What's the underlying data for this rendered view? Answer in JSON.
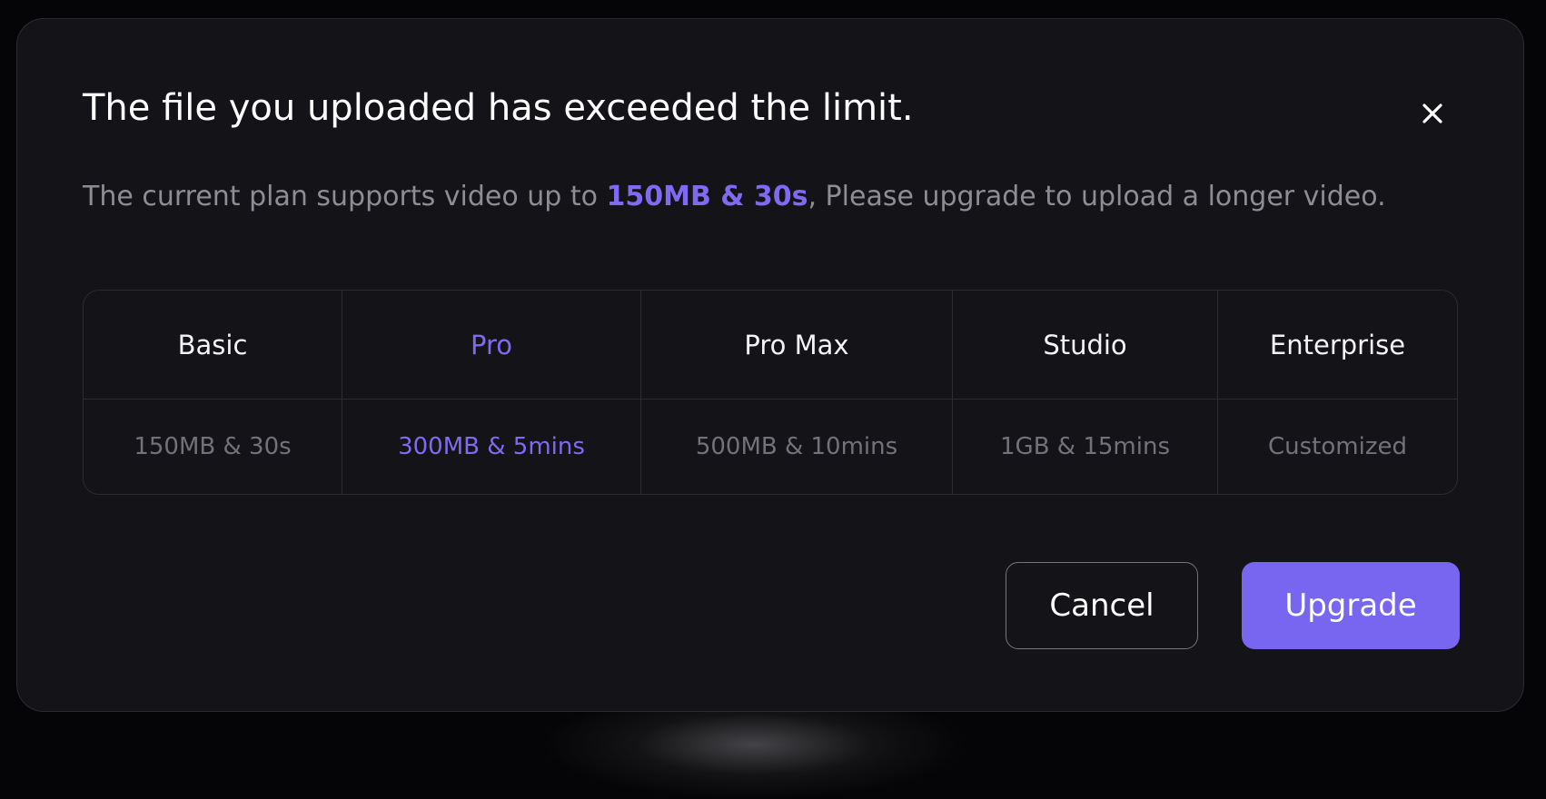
{
  "dialog": {
    "title": "The file you uploaded has exceeded the limit.",
    "subtitle_prefix": "The current plan supports video up to ",
    "subtitle_highlight": "150MB & 30s",
    "subtitle_suffix": ", Please upgrade to upload a longer video.",
    "close_icon": "close-icon"
  },
  "plans": [
    {
      "name": "Basic",
      "limit": "150MB & 30s",
      "highlighted": false
    },
    {
      "name": "Pro",
      "limit": "300MB & 5mins",
      "highlighted": true
    },
    {
      "name": "Pro Max",
      "limit": "500MB & 10mins",
      "highlighted": false
    },
    {
      "name": "Studio",
      "limit": "1GB & 15mins",
      "highlighted": false
    },
    {
      "name": "Enterprise",
      "limit": "Customized",
      "highlighted": false
    }
  ],
  "actions": {
    "cancel_label": "Cancel",
    "upgrade_label": "Upgrade"
  },
  "colors": {
    "accent": "#7866f0",
    "background": "#131318",
    "border": "#2b2b31",
    "muted_text": "#8d8d94"
  }
}
